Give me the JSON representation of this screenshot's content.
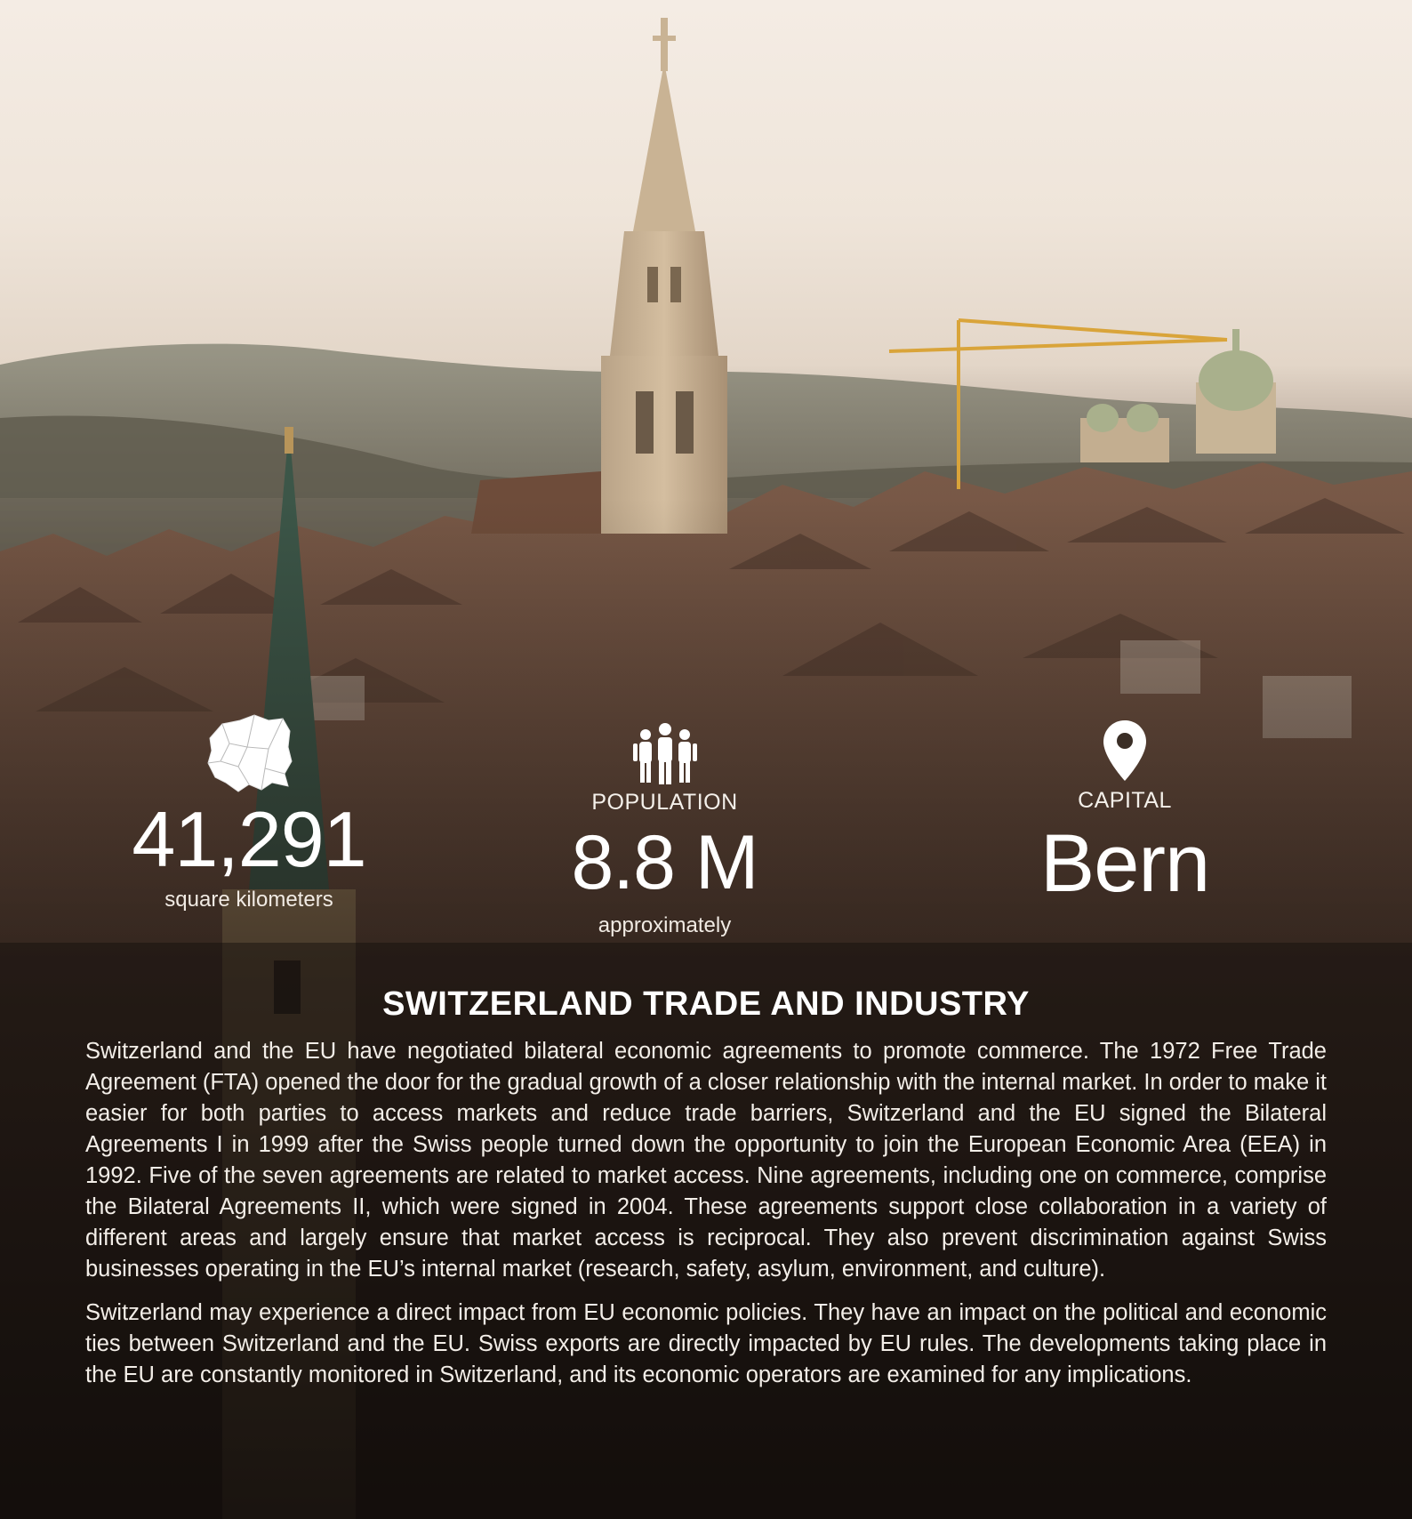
{
  "stats": {
    "area": {
      "value": "41,291",
      "caption": "square kilometers",
      "icon": "country-map-icon"
    },
    "population": {
      "label": "POPULATION",
      "value": "8.8 M",
      "caption": "approximately",
      "icon": "people-group-icon"
    },
    "capital": {
      "label": "CAPITAL",
      "value": "Bern",
      "icon": "map-pin-icon"
    }
  },
  "article": {
    "heading": "SWITZERLAND TRADE AND INDUSTRY",
    "paragraphs": [
      "Switzerland and the EU have negotiated bilateral economic agreements to promote commerce. The 1972 Free Trade Agreement (FTA) opened the door for the gradual growth of a closer relationship with the internal market. In order to make it easier for both parties to access markets and reduce trade barriers, Switzerland and the EU signed the Bilateral Agreements I in 1999 after the Swiss people turned down the opportunity to join the European Economic Area (EEA) in 1992. Five of the seven agreements are related to market access. Nine agreements, including one on commerce, comprise the Bilateral Agreements II, which were signed in 2004. These agreements support close collaboration in a variety of different areas and largely ensure that market access is reciprocal. They also prevent discrimination against Swiss businesses operating in the EU’s internal market (research, safety, asylum, environment, and culture).",
      "Switzerland may experience a direct impact from EU economic policies. They have an impact on the political and economic ties between Switzerland and the EU. Swiss exports are directly impacted by EU rules. The developments taking place in the EU are constantly monitored in Switzerland, and its economic operators are examined for any implications."
    ]
  }
}
